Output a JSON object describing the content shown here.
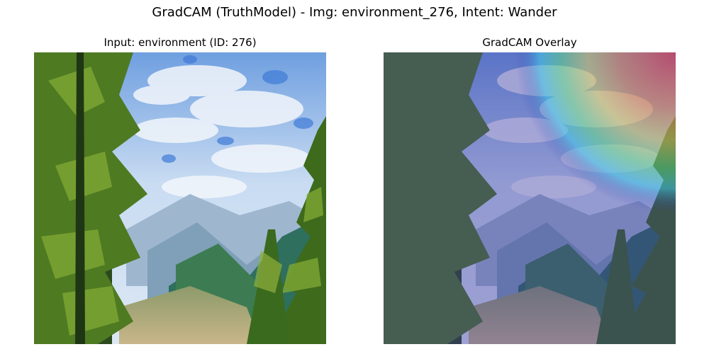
{
  "figure": {
    "suptitle": "GradCAM (TruthModel) - Img: environment_276, Intent: Wander"
  },
  "panels": [
    {
      "title": "Input: environment (ID: 276)"
    },
    {
      "title": "GradCAM Overlay"
    }
  ]
}
